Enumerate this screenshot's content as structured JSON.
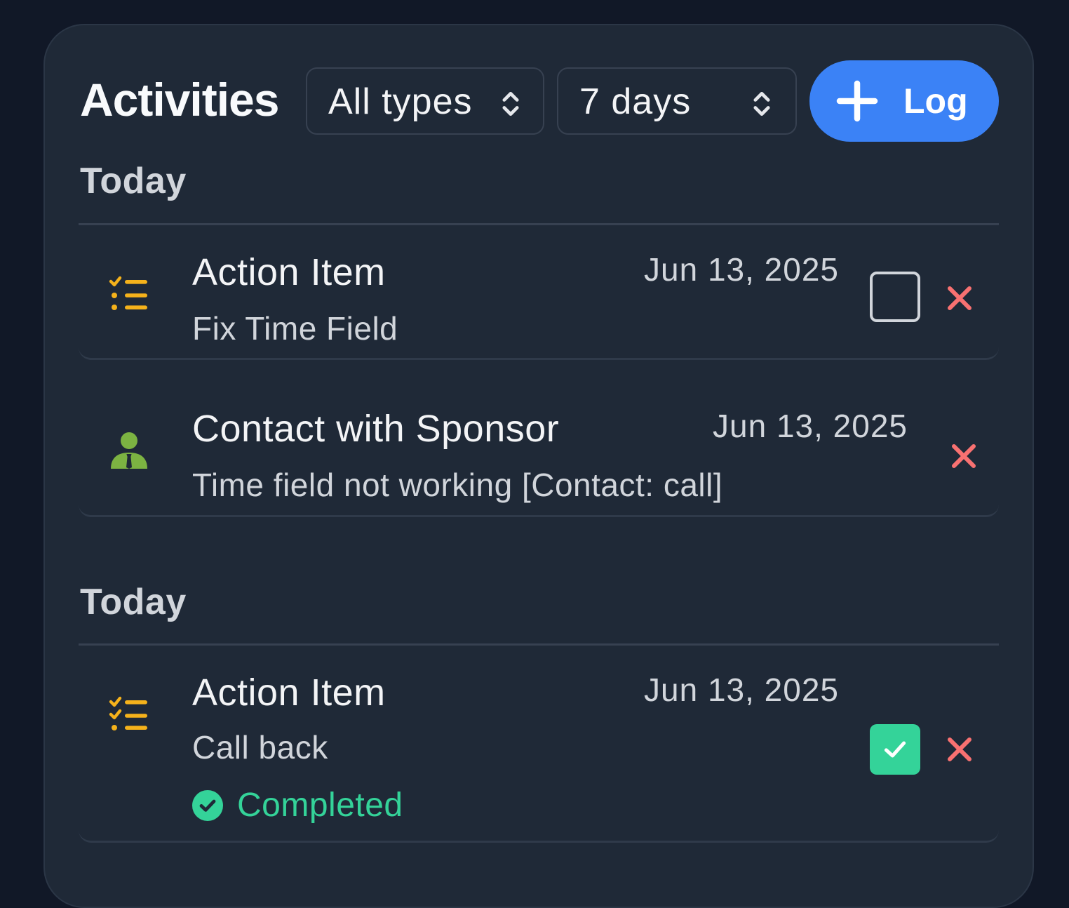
{
  "header": {
    "title": "Activities",
    "type_filter": {
      "selected": "All types"
    },
    "range_filter": {
      "selected": "7 days"
    },
    "log_button_label": "Log"
  },
  "groups": [
    {
      "label": "Today",
      "items": [
        {
          "icon": "checklist-icon",
          "title": "Action Item",
          "subtitle": "Fix Time Field",
          "date": "Jun 13, 2025",
          "checkbox": "unchecked"
        },
        {
          "icon": "person-icon",
          "title": "Contact with Sponsor",
          "subtitle": "Time field not working [Contact: call]",
          "date": "Jun 13, 2025"
        }
      ]
    },
    {
      "label": "Today",
      "items": [
        {
          "icon": "checklist-icon",
          "title": "Action Item",
          "subtitle": "Call back",
          "date": "Jun 13, 2025",
          "checkbox": "checked",
          "status": "Completed"
        }
      ]
    }
  ],
  "colors": {
    "background": "#111827",
    "panel": "#1f2937",
    "accent": "#3b82f6",
    "success": "#34d399",
    "danger": "#f87171",
    "checklist_icon": "#f5b21b",
    "person_icon": "#7cb342"
  }
}
